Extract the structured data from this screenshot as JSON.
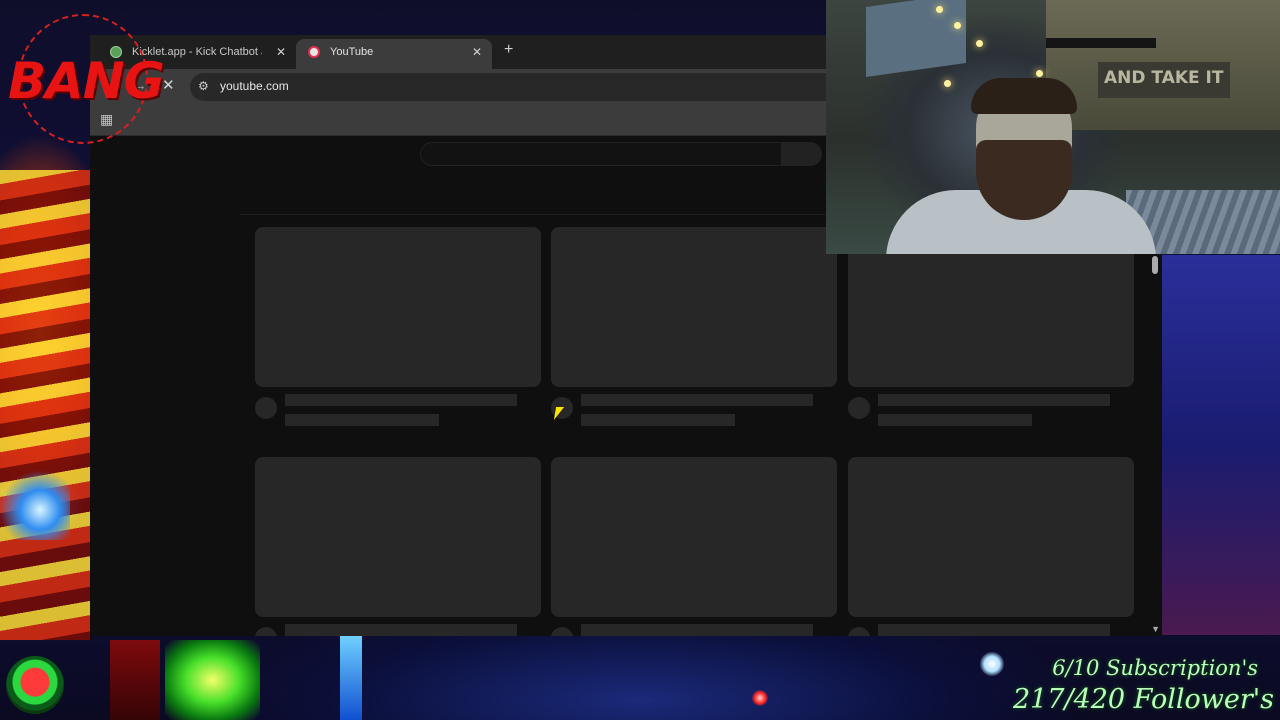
{
  "stream": {
    "logo_text": "BANG",
    "subscription_goal": "6/10 Subscription's",
    "follower_goal": "217/420 Follower's"
  },
  "browser": {
    "tabs": [
      {
        "label": "Kicklet.app - Kick Chatbot and",
        "active": false,
        "close": "✕"
      },
      {
        "label": "YouTube",
        "active": true,
        "close": "✕"
      }
    ],
    "new_tab": "+",
    "nav": {
      "back": "←",
      "forward": "→",
      "stop": "✕"
    },
    "site_info_icon": "⚙",
    "url": "youtube.com",
    "apps_icon": "▦",
    "scroll_down": "▼"
  },
  "webcam": {
    "poster_text": "AND TAKE IT"
  },
  "colors": {
    "page_bg": "#0f0f0f",
    "skeleton": "#272727",
    "toolbar": "#3c3c3c",
    "goal_text": "#b8ffb8",
    "logo_red": "#e81414"
  }
}
